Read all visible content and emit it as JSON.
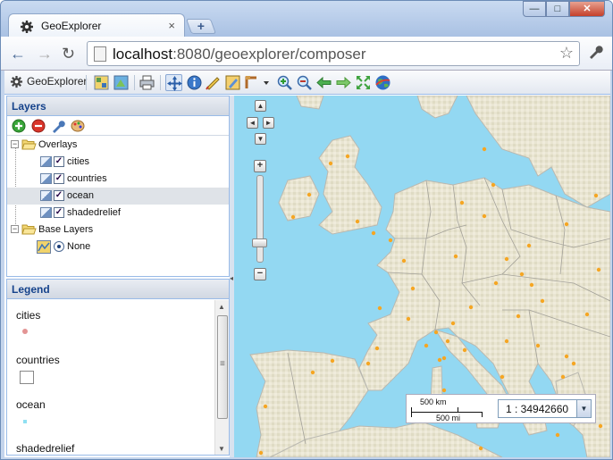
{
  "browser": {
    "tab_title": "GeoExplorer",
    "tab_close": "×",
    "new_tab": "+",
    "url_host": "localhost",
    "url_rest": ":8080/geoexplorer/composer",
    "win_min": "—",
    "win_max": "□",
    "win_close": "✕",
    "back": "←",
    "forward": "→",
    "reload": "↻",
    "star": "☆",
    "wrench": "🔧"
  },
  "toolbar": {
    "brand": "GeoExplorer",
    "icons": [
      "map-icon",
      "publish-icon",
      "print-icon",
      "pan-icon",
      "info-icon",
      "measure-icon",
      "edit-icon",
      "tool-dropdown-icon",
      "zoom-in-icon",
      "zoom-out-icon",
      "back-icon",
      "forward-icon",
      "max-extent-icon",
      "globe-icon"
    ]
  },
  "layers": {
    "title": "Layers",
    "overlays_label": "Overlays",
    "items": [
      {
        "label": "cities",
        "checked": "✓"
      },
      {
        "label": "countries",
        "checked": "✓"
      },
      {
        "label": "ocean",
        "checked": "✓"
      },
      {
        "label": "shadedrelief",
        "checked": "✓"
      }
    ],
    "base_label": "Base Layers",
    "base_items": [
      {
        "label": "None"
      }
    ],
    "expand_symbol": "−"
  },
  "legend": {
    "title": "Legend",
    "entries": [
      "cities",
      "countries",
      "ocean",
      "shadedrelief"
    ]
  },
  "map": {
    "pan_up": "▲",
    "pan_left": "◄",
    "pan_right": "►",
    "pan_down": "▼",
    "zoom_in": "+",
    "zoom_out": "−",
    "scale_km": "500 km",
    "scale_mi": "500 mi",
    "scale_value": "1 : 34942660",
    "scale_dropdown": "▼",
    "colors": {
      "sea": "#93d8f2",
      "land": "#e7e3cf",
      "city": "#f5a623"
    }
  },
  "panel": {
    "collapse": "◂",
    "scroll_up": "▲",
    "scroll_grip": "≡",
    "scroll_down": "▼"
  }
}
